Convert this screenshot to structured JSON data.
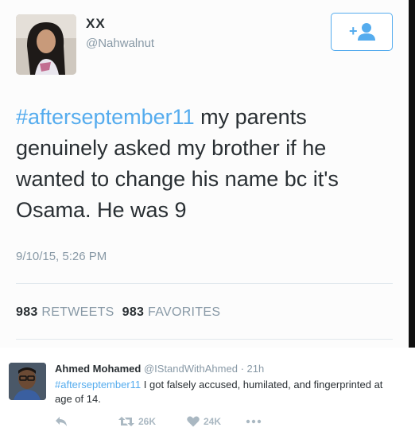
{
  "tweet": {
    "name": "XX",
    "handle": "@Nahwalnut",
    "hashtag": "#afterseptember11",
    "text": " my parents genuinely asked my brother if he wanted to change his name bc it's Osama. He was 9",
    "timestamp": "9/10/15, 5:26 PM",
    "retweets_count": "983",
    "retweets_label": "RETWEETS",
    "favorites_count": "983",
    "favorites_label": "FAVORITES",
    "follow_icon": "add-user-icon"
  },
  "reply": {
    "name": "Ahmed Mohamed",
    "handle": "@IStandWithAhmed",
    "time": "· 21h",
    "hashtag": "#afterseptember11",
    "text": " I got falsely accused, humilated, and fingerprinted at age of 14.",
    "retweet_count": "26K",
    "like_count": "24K",
    "icons": {
      "reply": "reply-arrow-icon",
      "retweet": "retweet-icon",
      "like": "heart-icon",
      "more": "more-dots-icon"
    }
  },
  "colors": {
    "accent": "#55acee",
    "text": "#292f33",
    "muted": "#8899a6",
    "action_gray": "#aab8c2"
  }
}
